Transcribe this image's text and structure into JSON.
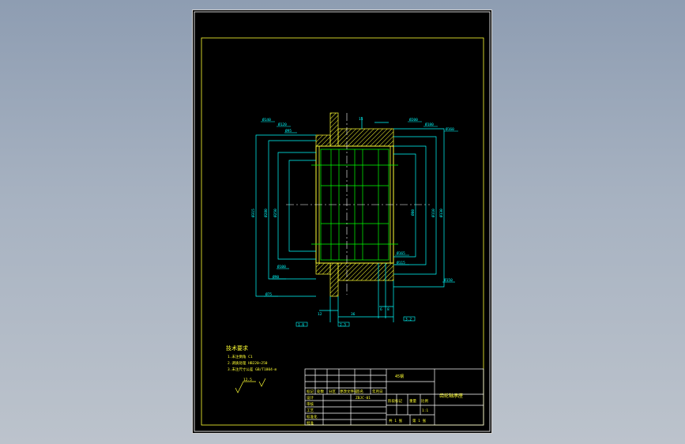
{
  "sheet": {
    "background": "#000000",
    "outer_frame_color": "#ffffff",
    "inner_frame_color": "#ffff33"
  },
  "drawing": {
    "line_colors": {
      "outline": "#ffff33",
      "hatch": "#ffff33",
      "dimension": "#00ffff",
      "feature": "#00ff00",
      "centerline": "#ffffff"
    },
    "dimension_labels": {
      "top_left": [
        "Ø140",
        "Ø120",
        "Ø95"
      ],
      "top_right": [
        "Ø200",
        "Ø180",
        "Ø160"
      ],
      "left_side": [
        "Ø315",
        "Ø280",
        "Ø250"
      ],
      "right_side": [
        "Ø80",
        "Ø110",
        "Ø130"
      ],
      "bottom_left": [
        "Ø100",
        "Ø90",
        "Ø75"
      ],
      "bottom_right": [
        "Ø165",
        "Ø115",
        "Ø150"
      ],
      "bottom_edge": [
        "1.6",
        "2.5",
        "3.2"
      ],
      "axial": [
        "12",
        "36",
        "6",
        "8",
        "15"
      ]
    }
  },
  "notes": {
    "heading": "技术要求",
    "lines": [
      "1.未注倒角 C1",
      "2.调质处理 HB220~250",
      "3.未注尺寸公差 GB/T1804-m"
    ],
    "roughness_label": "12.5"
  },
  "title_block": {
    "material": "45钢",
    "part_name": "齿轮轴承座",
    "scale_label": "比例",
    "scale_value": "1:1",
    "drawing_no": "ZBJC-01",
    "sheet_info": [
      "共 1 张",
      "第 1 张"
    ],
    "stage_label": "阶段标记",
    "weight_label": "重量",
    "row_labels": [
      "标记",
      "处数",
      "分区",
      "更改文件号",
      "签名",
      "年月日"
    ],
    "sign_labels": [
      "设计",
      "审核",
      "工艺",
      "标准化",
      "批准"
    ]
  }
}
